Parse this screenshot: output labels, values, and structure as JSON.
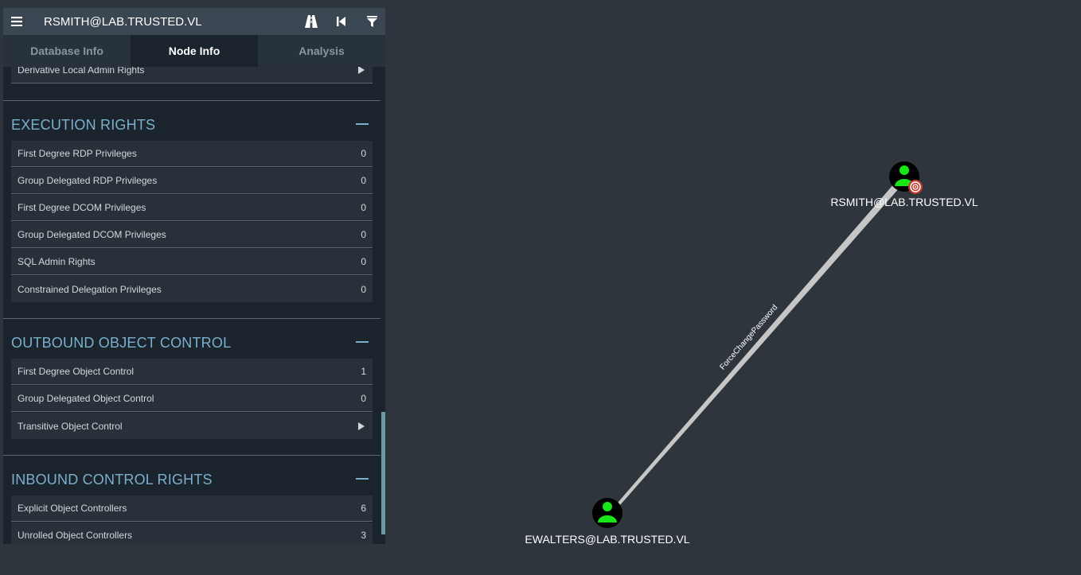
{
  "search": {
    "value": "RSMITH@LAB.TRUSTED.VL"
  },
  "toolbar": {
    "menu_icon": "hamburger-menu-icon",
    "path_icon": "road-icon",
    "back_icon": "step-backward-icon",
    "filter_icon": "filter-icon"
  },
  "tabs": [
    {
      "label": "Database Info",
      "active": false
    },
    {
      "label": "Node Info",
      "active": true
    },
    {
      "label": "Analysis",
      "active": false
    }
  ],
  "sections": {
    "top_partial": {
      "rows": [
        {
          "label": "Derivative Local Admin Rights",
          "expand": true
        }
      ]
    },
    "execution_rights": {
      "title": "EXECUTION RIGHTS",
      "rows": [
        {
          "label": "First Degree RDP Privileges",
          "value": "0"
        },
        {
          "label": "Group Delegated RDP Privileges",
          "value": "0"
        },
        {
          "label": "First Degree DCOM Privileges",
          "value": "0"
        },
        {
          "label": "Group Delegated DCOM Privileges",
          "value": "0"
        },
        {
          "label": "SQL Admin Rights",
          "value": "0"
        },
        {
          "label": "Constrained Delegation Privileges",
          "value": "0"
        }
      ]
    },
    "outbound_object_control": {
      "title": "OUTBOUND OBJECT CONTROL",
      "rows": [
        {
          "label": "First Degree Object Control",
          "value": "1"
        },
        {
          "label": "Group Delegated Object Control",
          "value": "0"
        },
        {
          "label": "Transitive Object Control",
          "expand": true
        }
      ]
    },
    "inbound_control_rights": {
      "title": "INBOUND CONTROL RIGHTS",
      "rows": [
        {
          "label": "Explicit Object Controllers",
          "value": "6"
        },
        {
          "label": "Unrolled Object Controllers",
          "value": "3"
        }
      ]
    }
  },
  "graph": {
    "nodes": [
      {
        "label": "RSMITH@LAB.TRUSTED.VL",
        "icon": "user-icon",
        "badge": "target-icon"
      },
      {
        "label": "EWALTERS@LAB.TRUSTED.VL",
        "icon": "user-icon"
      }
    ],
    "edge": {
      "label": "ForceChangePassword"
    }
  },
  "colors": {
    "background": "#2e353c",
    "panel": "#1b232c",
    "section_title": "#7ab0cc",
    "user_node": "#19e619",
    "target_badge": "#c0392b"
  }
}
